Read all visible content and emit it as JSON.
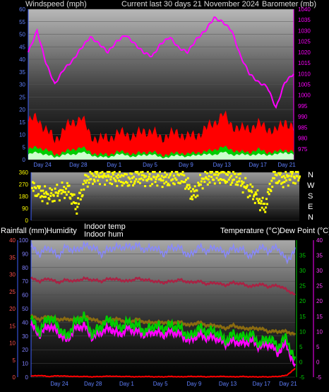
{
  "header": {
    "wind_label": "Windspeed (mph)",
    "title": "Current last 30 days 21 November 2024",
    "baro_label": "Barometer (mb)"
  },
  "mid": {
    "compass": [
      "N",
      "W",
      "S",
      "E",
      "N"
    ]
  },
  "lower": {
    "rain_label": "Rainfall (mm)",
    "hum_label": "Humidity",
    "indoor_temp_label": "Indoor temp",
    "indoor_hum_label": "Indoor hum",
    "temp_label": "Temperature (°C)",
    "dew_label": "Dew Point (°C)"
  },
  "colors": {
    "gust": "#ff0000",
    "wind": "#00cc00",
    "wind_avg": "#ccffcc",
    "barometer": "#ff00ff",
    "direction": "#ffff00",
    "humidity": "#8888ff",
    "indoor_hum": "#aa2244",
    "indoor_temp": "#8a6a10",
    "temperature": "#00cc00",
    "dew_point": "#ff00ff",
    "rain": "#ff0000"
  },
  "chart_data": [
    {
      "type": "area",
      "title": "Current last 30 days 21 November 2024",
      "ylabel": "Windspeed (mph)",
      "y2label": "Barometer (mb)",
      "ylim": [
        0,
        60
      ],
      "y2lim": [
        970,
        1040
      ],
      "yticks": [
        0,
        5,
        10,
        15,
        20,
        25,
        30,
        35,
        40,
        45,
        50,
        55,
        60
      ],
      "y2ticks": [
        975,
        980,
        985,
        990,
        995,
        1000,
        1005,
        1010,
        1015,
        1020,
        1025,
        1030,
        1035,
        1040
      ],
      "xticks": [
        "Day 24",
        "Day 28",
        "Day 1",
        "Day 5",
        "Day 9",
        "Day 13",
        "Day 17",
        "Day 21"
      ],
      "x_days": [
        0,
        2,
        4,
        6,
        8,
        10,
        12,
        14,
        16,
        18,
        20,
        22,
        24,
        26,
        28,
        30
      ],
      "series": [
        {
          "name": "Barometer",
          "axis": "right",
          "x": [
            0,
            1,
            2,
            3,
            4,
            5,
            6,
            7,
            8,
            9,
            10,
            11,
            12,
            13,
            14,
            15,
            16,
            17,
            18,
            19,
            20,
            21,
            22,
            23,
            24,
            25,
            26,
            27,
            28,
            29,
            30
          ],
          "values": [
            1020,
            1030,
            1015,
            1005,
            1012,
            1016,
            1022,
            1027,
            1024,
            1020,
            1025,
            1028,
            1024,
            1020,
            1018,
            1024,
            1027,
            1022,
            1020,
            1026,
            1030,
            1036,
            1034,
            1030,
            1018,
            1010,
            1006,
            1004,
            994,
            1006,
            1010
          ]
        },
        {
          "name": "Gust",
          "axis": "left",
          "x": [
            0,
            1,
            2,
            3,
            4,
            5,
            6,
            7,
            8,
            9,
            10,
            11,
            12,
            13,
            14,
            15,
            16,
            17,
            18,
            19,
            20,
            21,
            22,
            23,
            24,
            25,
            26,
            27,
            28,
            29,
            30
          ],
          "values": [
            15,
            17,
            12,
            8,
            12,
            15,
            17,
            10,
            8,
            9,
            10,
            11,
            9,
            12,
            11,
            9,
            10,
            11,
            9,
            10,
            12,
            15,
            18,
            14,
            12,
            13,
            14,
            13,
            11,
            16,
            12
          ]
        },
        {
          "name": "Wind",
          "axis": "left",
          "x": [
            0,
            1,
            2,
            3,
            4,
            5,
            6,
            7,
            8,
            9,
            10,
            11,
            12,
            13,
            14,
            15,
            16,
            17,
            18,
            19,
            20,
            21,
            22,
            23,
            24,
            25,
            26,
            27,
            28,
            29,
            30
          ],
          "values": [
            4,
            5,
            4,
            2,
            3,
            4,
            5,
            3,
            2,
            2,
            3,
            3,
            2,
            3,
            3,
            2,
            2,
            3,
            2,
            3,
            3,
            4,
            5,
            4,
            3,
            3,
            4,
            3,
            3,
            4,
            3
          ]
        },
        {
          "name": "Average wind",
          "axis": "left",
          "x": [
            0,
            1,
            2,
            3,
            4,
            5,
            6,
            7,
            8,
            9,
            10,
            11,
            12,
            13,
            14,
            15,
            16,
            17,
            18,
            19,
            20,
            21,
            22,
            23,
            24,
            25,
            26,
            27,
            28,
            29,
            30
          ],
          "values": [
            2,
            3,
            2,
            1,
            2,
            2,
            3,
            2,
            1,
            1,
            2,
            2,
            1,
            2,
            2,
            1,
            1,
            2,
            1,
            2,
            2,
            2,
            3,
            2,
            2,
            2,
            2,
            2,
            2,
            3,
            2
          ]
        }
      ]
    },
    {
      "type": "scatter",
      "ylabel": "",
      "ylim": [
        0,
        360
      ],
      "yticks": [
        0,
        90,
        180,
        270,
        360
      ],
      "series": [
        {
          "name": "Wind direction",
          "x": [
            0,
            1,
            2,
            3,
            4,
            5,
            6,
            7,
            8,
            9,
            10,
            11,
            12,
            13,
            14,
            15,
            16,
            17,
            18,
            19,
            20,
            21,
            22,
            23,
            24,
            25,
            26,
            27,
            28,
            29,
            30
          ],
          "values": [
            240,
            200,
            180,
            210,
            230,
            100,
            300,
            330,
            330,
            320,
            310,
            300,
            330,
            310,
            320,
            300,
            320,
            310,
            180,
            300,
            330,
            330,
            320,
            310,
            240,
            180,
            90,
            330,
            300,
            330,
            320
          ]
        }
      ]
    },
    {
      "type": "line",
      "ylabel": "Humidity",
      "y2label": "Temperature (°C)",
      "ylim": [
        0,
        100
      ],
      "yticks": [
        0,
        10,
        20,
        30,
        40,
        50,
        60,
        70,
        80,
        90,
        100
      ],
      "rain_ylim": [
        0,
        40
      ],
      "rain_yticks": [
        0,
        5,
        10,
        15,
        20,
        25,
        30,
        35,
        40
      ],
      "temp_ylim": [
        -5,
        40
      ],
      "temp_yticks": [
        -5,
        0,
        5,
        10,
        15,
        20,
        25,
        30,
        35
      ],
      "dew_yticks": [
        -5,
        0,
        5,
        10,
        15,
        20,
        25,
        30,
        35,
        40
      ],
      "xticks": [
        "Day 24",
        "Day 28",
        "Day 1",
        "Day 5",
        "Day 9",
        "Day 13",
        "Day 17",
        "Day 21"
      ],
      "series": [
        {
          "name": "Humidity",
          "axis": "humidity",
          "x": [
            0,
            1,
            2,
            3,
            4,
            5,
            6,
            7,
            8,
            9,
            10,
            11,
            12,
            13,
            14,
            15,
            16,
            17,
            18,
            19,
            20,
            21,
            22,
            23,
            24,
            25,
            26,
            27,
            28,
            29,
            30
          ],
          "values": [
            95,
            90,
            95,
            88,
            95,
            92,
            96,
            95,
            90,
            94,
            95,
            95,
            96,
            93,
            95,
            90,
            95,
            94,
            88,
            95,
            92,
            95,
            90,
            94,
            93,
            88,
            95,
            92,
            95,
            85,
            92
          ]
        },
        {
          "name": "Indoor hum",
          "axis": "humidity",
          "x": [
            0,
            1,
            2,
            3,
            4,
            5,
            6,
            7,
            8,
            9,
            10,
            11,
            12,
            13,
            14,
            15,
            16,
            17,
            18,
            19,
            20,
            21,
            22,
            23,
            24,
            25,
            26,
            27,
            28,
            29,
            30
          ],
          "values": [
            72,
            70,
            72,
            69,
            71,
            70,
            72,
            71,
            70,
            72,
            71,
            70,
            72,
            71,
            70,
            69,
            70,
            71,
            69,
            70,
            68,
            69,
            67,
            69,
            68,
            66,
            68,
            66,
            67,
            64,
            60
          ]
        },
        {
          "name": "Indoor temp",
          "axis": "temp",
          "x": [
            0,
            1,
            2,
            3,
            4,
            5,
            6,
            7,
            8,
            9,
            10,
            11,
            12,
            13,
            14,
            15,
            16,
            17,
            18,
            19,
            20,
            21,
            22,
            23,
            24,
            25,
            26,
            27,
            28,
            29,
            30
          ],
          "values": [
            15,
            14,
            15,
            14,
            14,
            14,
            15,
            14,
            13,
            14,
            14,
            13,
            14,
            13,
            13,
            13,
            13,
            13,
            12,
            13,
            12,
            12,
            11,
            12,
            11,
            11,
            11,
            10,
            10,
            10,
            9
          ]
        },
        {
          "name": "Temperature",
          "axis": "temp",
          "x": [
            0,
            1,
            2,
            3,
            4,
            5,
            6,
            7,
            8,
            9,
            10,
            11,
            12,
            13,
            14,
            15,
            16,
            17,
            18,
            19,
            20,
            21,
            22,
            23,
            24,
            25,
            26,
            27,
            28,
            29,
            30
          ],
          "values": [
            14,
            10,
            15,
            12,
            8,
            13,
            15,
            9,
            12,
            14,
            11,
            13,
            12,
            10,
            12,
            11,
            12,
            11,
            8,
            11,
            10,
            10,
            7,
            9,
            8,
            9,
            6,
            8,
            5,
            8,
            0
          ]
        },
        {
          "name": "Dew Point",
          "axis": "temp",
          "x": [
            0,
            1,
            2,
            3,
            4,
            5,
            6,
            7,
            8,
            9,
            10,
            11,
            12,
            13,
            14,
            15,
            16,
            17,
            18,
            19,
            20,
            21,
            22,
            23,
            24,
            25,
            26,
            27,
            28,
            29,
            30
          ],
          "values": [
            12,
            9,
            12,
            10,
            7,
            11,
            12,
            8,
            10,
            11,
            9,
            11,
            10,
            9,
            10,
            9,
            10,
            9,
            7,
            9,
            8,
            8,
            6,
            7,
            6,
            7,
            5,
            6,
            3,
            6,
            -2
          ]
        },
        {
          "name": "Rainfall",
          "axis": "rain",
          "x": [
            0,
            1,
            2,
            3,
            4,
            5,
            6,
            7,
            8,
            9,
            10,
            11,
            12,
            13,
            14,
            15,
            16,
            17,
            18,
            19,
            20,
            21,
            22,
            23,
            24,
            25,
            26,
            27,
            28,
            29,
            30
          ],
          "values": [
            0.3,
            0.5,
            0.2,
            0.4,
            0.3,
            0.2,
            0.2,
            0.1,
            0.2,
            0.3,
            0.2,
            0.2,
            0.1,
            0.2,
            0.1,
            0.1,
            0.2,
            0.1,
            0.2,
            0.2,
            0.1,
            0.2,
            0.2,
            0.1,
            0.2,
            0.1,
            0.1,
            0.1,
            0.2,
            0.5,
            2.5
          ]
        }
      ]
    }
  ]
}
